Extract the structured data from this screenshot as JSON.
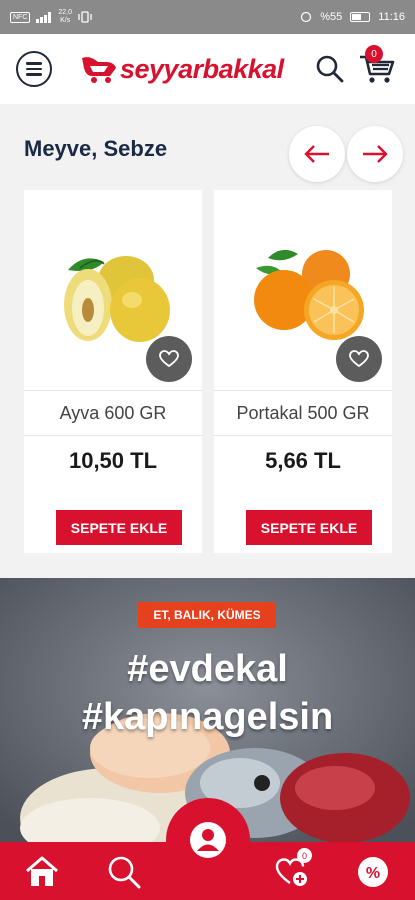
{
  "status_bar": {
    "speed": "22,0\nK/s",
    "battery_text": "%55",
    "battery_level": 0.55,
    "time": "11:16"
  },
  "header": {
    "logo_text": "seyyarbakkal",
    "cart_count": "0",
    "brand_color": "#d8112e"
  },
  "section": {
    "title": "Meyve, Sebze"
  },
  "products": [
    {
      "name": "Ayva 600 GR",
      "price": "10,50 TL",
      "button": "SEPETE EKLE",
      "image": "quince-image"
    },
    {
      "name": "Portakal 500 GR",
      "price": "5,66 TL",
      "button": "SEPETE EKLE",
      "image": "orange-image"
    }
  ],
  "banner": {
    "tag": "ET, BALIK, KÜMES",
    "line1": "#evdekal",
    "line2": "#kapınagelsin"
  },
  "bottom_nav": {
    "favorites_count": "0",
    "icons": [
      "home-icon",
      "search-icon",
      "profile-icon",
      "heart-plus-icon",
      "discount-icon"
    ]
  }
}
